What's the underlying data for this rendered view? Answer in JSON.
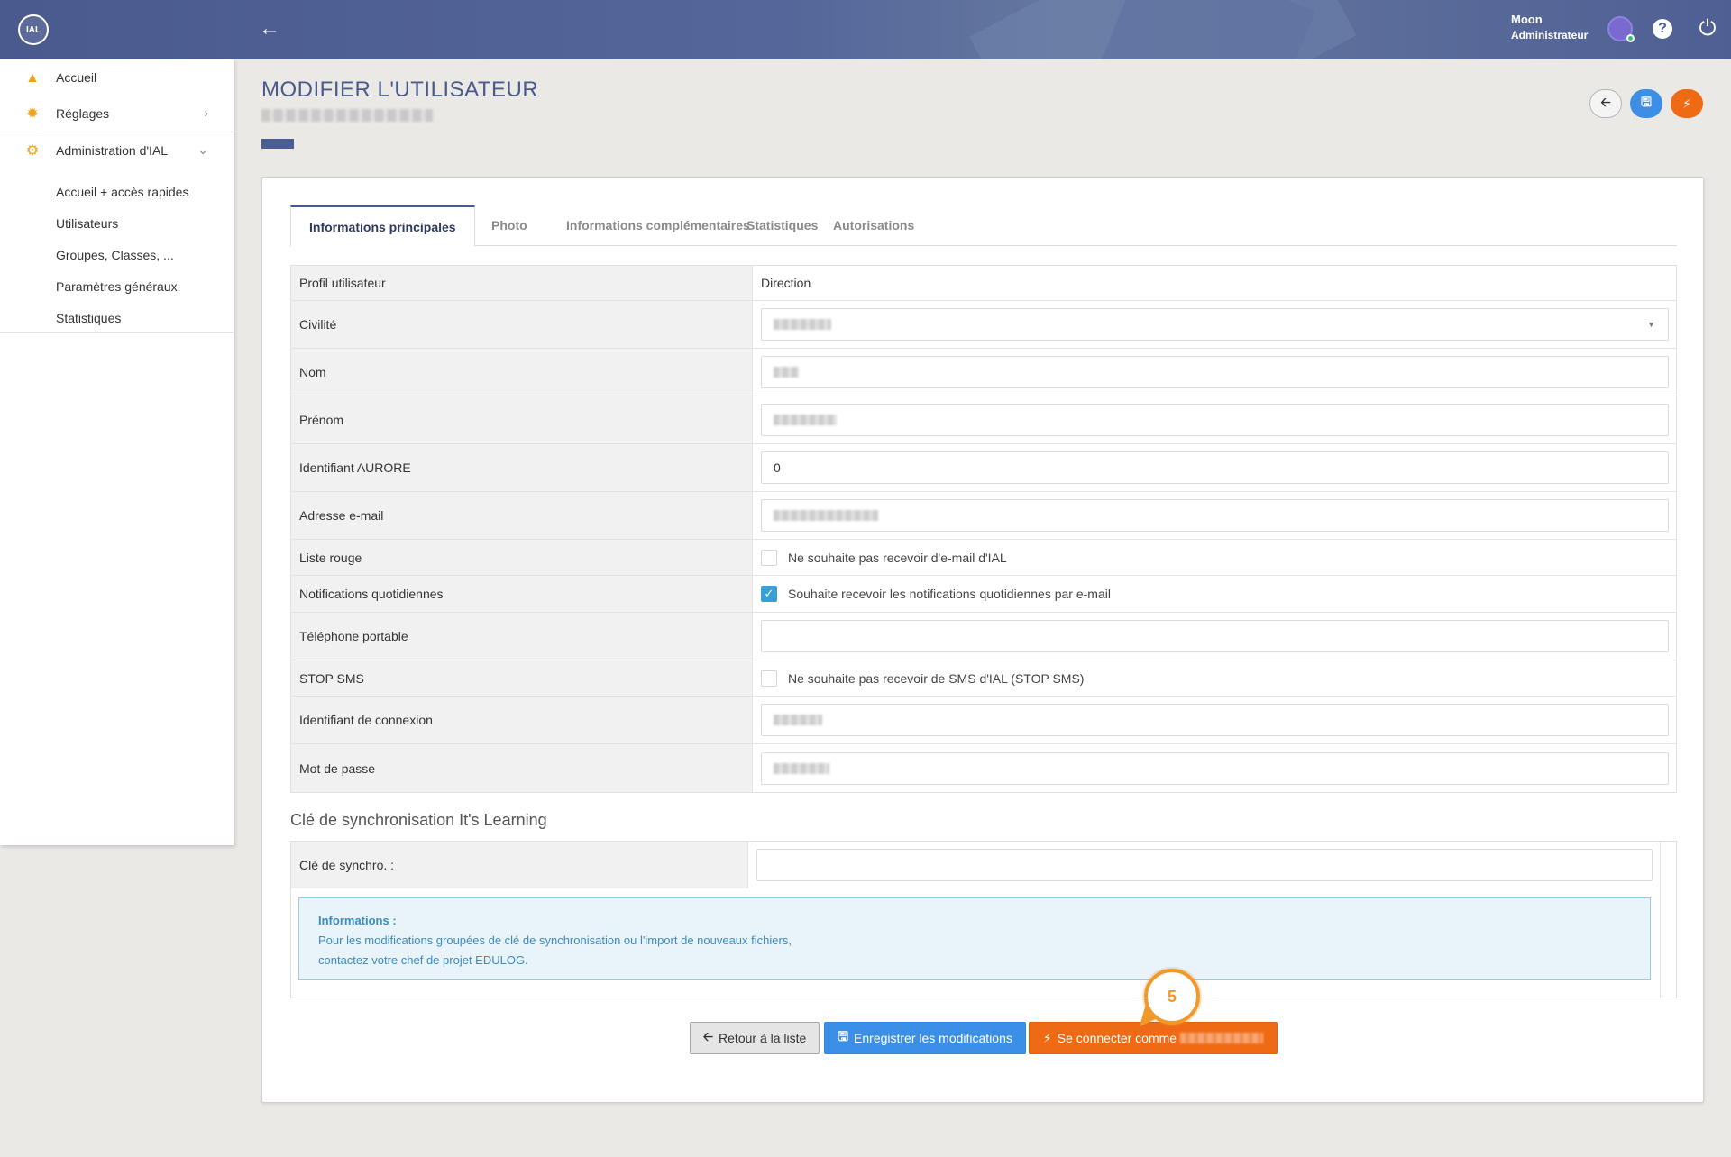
{
  "topbar": {
    "logo_text": "IAL",
    "back_icon": "arrow-left-icon",
    "user_name": "Moon",
    "user_role": "Administrateur",
    "help_icon": "?",
    "power_icon": "⏻"
  },
  "sidebar": {
    "items": [
      {
        "label": "Accueil",
        "icon": "home-icon"
      },
      {
        "label": "Réglages",
        "icon": "gears-icon"
      },
      {
        "label": "Administration d'IAL",
        "icon": "gear-icon"
      }
    ],
    "subitems": [
      {
        "label": "Accueil + accès rapides"
      },
      {
        "label": "Utilisateurs"
      },
      {
        "label": "Groupes, Classes, ..."
      },
      {
        "label": "Paramètres généraux"
      },
      {
        "label": "Statistiques"
      }
    ]
  },
  "page": {
    "title": "MODIFIER L'UTILISATEUR"
  },
  "tabs": [
    {
      "label": "Informations principales",
      "active": true
    },
    {
      "label": "Photo"
    },
    {
      "label": "Informations complémentaires"
    },
    {
      "label": "Statistiques"
    },
    {
      "label": "Autorisations"
    }
  ],
  "form": {
    "profil_label": "Profil utilisateur",
    "profil_value": "Direction",
    "civilite_label": "Civilité",
    "nom_label": "Nom",
    "prenom_label": "Prénom",
    "aurore_label": "Identifiant AURORE",
    "aurore_value": "0",
    "email_label": "Adresse e-mail",
    "liste_rouge_label": "Liste rouge",
    "liste_rouge_text": "Ne souhaite pas recevoir d'e-mail d'IAL",
    "notif_label": "Notifications quotidiennes",
    "notif_text": "Souhaite recevoir les notifications quotidiennes par e-mail",
    "tel_label": "Téléphone portable",
    "stop_sms_label": "STOP SMS",
    "stop_sms_text": "Ne souhaite pas recevoir de SMS d'IAL (STOP SMS)",
    "login_label": "Identifiant de connexion",
    "password_label": "Mot de passe"
  },
  "sync": {
    "section_title": "Clé de synchronisation It's Learning",
    "key_label": "Clé de synchro. :",
    "info_title": "Informations :",
    "info_line1": "Pour les modifications groupées de clé de synchronisation ou l'import de nouveaux fichiers,",
    "info_line2": "contactez votre chef de projet EDULOG."
  },
  "actions": {
    "back_label": "Retour à la liste",
    "save_label": "Enregistrer les modifications",
    "login_label": "Se connecter comme"
  },
  "callout": {
    "number": "5"
  },
  "colors": {
    "topbar": "#4a5a8e",
    "accent_orange": "#ef6a14",
    "accent_blue": "#3c8fe6",
    "sidebar_icon": "#f2a11a",
    "callout": "#f1982a"
  }
}
